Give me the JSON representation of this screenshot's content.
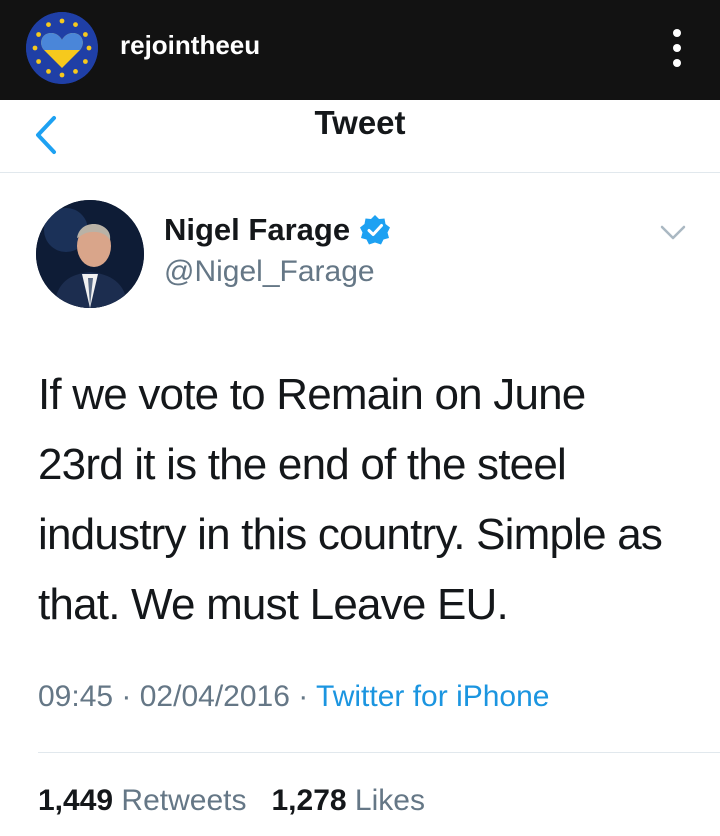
{
  "instagram": {
    "username": "rejointheeu",
    "colors": {
      "header_bg": "#121212",
      "eu_blue": "#1f3fa6",
      "heart_blue": "#4a86d9",
      "heart_yellow": "#f6c91d"
    }
  },
  "nav": {
    "title": "Tweet",
    "back_icon": "chevron-left-icon"
  },
  "tweet": {
    "author_name": "Nigel Farage",
    "handle": "@Nigel_Farage",
    "verified": true,
    "text": "If we vote to Remain on June 23rd it is the end of the steel industry in this country. Simple as that. We must Leave EU.",
    "time": "09:45",
    "date": "02/04/2016",
    "source": "Twitter for iPhone",
    "retweets_count": "1,449",
    "retweets_label": "Retweets",
    "likes_count": "1,278",
    "likes_label": "Likes"
  },
  "colors": {
    "accent": "#1da1f2",
    "text": "#14171a",
    "secondary": "#657786",
    "link": "#1b95e0"
  }
}
